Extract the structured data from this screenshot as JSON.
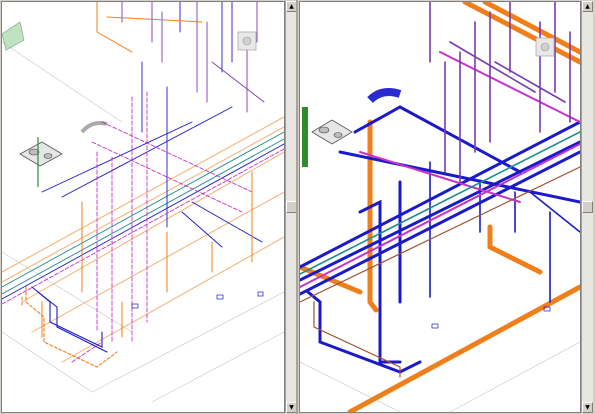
{
  "panes": [
    {
      "id": "left",
      "style": "hidden-line"
    },
    {
      "id": "right",
      "style": "shaded"
    }
  ],
  "scroll": {
    "up_arrow": "▲",
    "down_arrow": "▼",
    "left_position": 0.5,
    "right_position": 0.5
  },
  "colors": {
    "domestic_hot": "#f07f1a",
    "cold_water": "#1a1ac8",
    "recirculation": "#c832c8",
    "purple": "#7a3ab0",
    "green": "#2e8b2e",
    "teal": "#1e8c8c",
    "light_orange": "#f5b070",
    "grey": "#8a8a8a"
  }
}
